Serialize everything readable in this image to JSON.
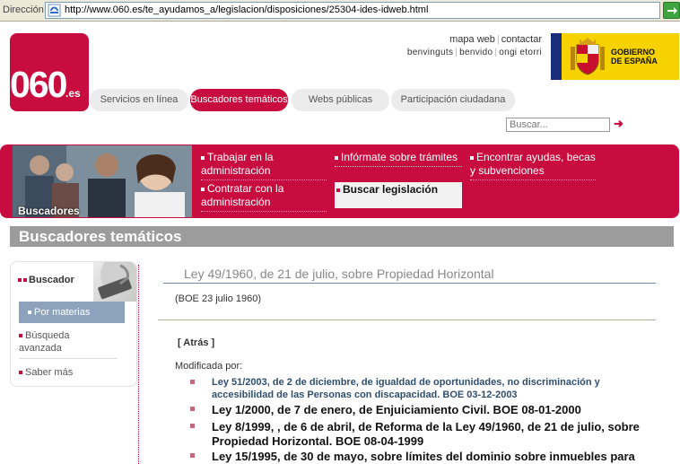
{
  "browser": {
    "address_label": "Dirección",
    "url": "http://www.060.es/te_ayudamos_a/legislacion/disposiciones/25304-ides-idweb.html"
  },
  "logo": {
    "number": "060",
    "suffix": ".es"
  },
  "toplinks": {
    "row1": [
      "mapa web",
      "contactar"
    ],
    "row2": [
      "benvinguts",
      "benvido",
      "ongi etorri"
    ]
  },
  "gobierno": {
    "line1": "GOBIERNO",
    "line2": "DE ESPAÑA"
  },
  "tabs": [
    "Servicios en línea",
    "Buscadores temáticos",
    "Webs públicas",
    "Participación ciudadana"
  ],
  "search": {
    "placeholder": "Buscar..."
  },
  "band": {
    "photo_label": "Buscadores",
    "links": [
      "Trabajar en la administración",
      "Infórmate sobre trámites",
      "Encontrar ayudas, becas y subvenciones",
      "Contratar con la administración",
      "Buscar legislación"
    ]
  },
  "section_title": "Buscadores temáticos",
  "nav": {
    "head": "Buscador",
    "items": [
      "Por materias",
      "Búsqueda avanzada",
      "Saber más"
    ]
  },
  "content": {
    "law_title": "Ley 49/1960, de 21 de julio, sobre Propiedad Horizontal",
    "boe": "(BOE 23 julio 1960)",
    "back": "[ Atrás ]",
    "modified_by": "Modificada por:",
    "modifications": [
      "Ley 51/2003, de 2 de diciembre, de igualdad de oportunidades, no discriminación y accesibilidad de las Personas con discapacidad. BOE 03-12-2003",
      "Ley 1/2000, de 7 de enero, de Enjuiciamiento Civil. BOE 08-01-2000",
      "Ley 8/1999, , de 6 de abril, de Reforma de la Ley 49/1960, de 21 de julio, sobre Propiedad Horizontal. BOE 08-04-1999",
      "Ley 15/1995, de 30 de mayo, sobre límites del dominio sobre inmuebles para"
    ]
  }
}
